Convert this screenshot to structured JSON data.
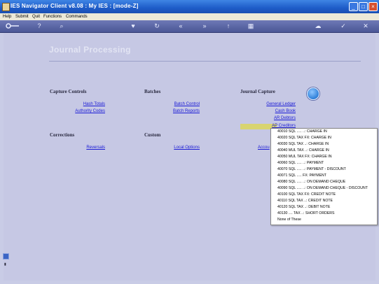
{
  "window": {
    "title": "IES Navigator Client v8.08 : My IES :      [mode-Z]"
  },
  "menu": [
    "Help",
    "Submit",
    "Quit",
    "Functions",
    "Commands"
  ],
  "page": {
    "title": "Journal Processing"
  },
  "sections": {
    "capture_controls": {
      "title": "Capture Controls",
      "links": [
        "Hash Totals",
        "Authority Codes"
      ]
    },
    "batches": {
      "title": "Batches",
      "links": [
        "Batch Control",
        "Batch Reports"
      ]
    },
    "journal_capture": {
      "title": "Journal Capture",
      "links": [
        "General Ledger",
        "Cash Book",
        "AR Debtors",
        "AP Creditors"
      ]
    },
    "corrections": {
      "title": "Corrections",
      "links": [
        "Reversals"
      ]
    },
    "custom": {
      "title": "Custom",
      "links": [
        "Local Options"
      ]
    },
    "partial_link": "Accou"
  },
  "popup": {
    "items": [
      "40010 SQL ..... ..: CHARGE IN",
      "40020 SQL TAX FX: CHARGE IN",
      "40030 SQL TAX ..: CHARGE IN",
      "40040 MUL TAX ..: CHARGE IN",
      "40050 MUL TAX FX: CHARGE IN",
      "40060 SQL ..... ..: PAYMENT",
      "40070 SQL ..... ..: PAYMENT - DISCOUNT",
      "40071 SQL ..... FX: PAYMENT",
      "40080 SQL ..... ..: ON DEMAND CHEQUE",
      "40090 SQL ..... ..: ON DEMAND CHEQUE - DISCOUNT",
      "40100 SQL TAX FX: CREDIT NOTE",
      "40110 SQL TAX ..: CREDIT NOTE",
      "40120 SQL TAX ..: DEBIT NOTE",
      "40130 .... TAX ..: SHORT ORDERS",
      "None of These"
    ]
  },
  "colors": {
    "titlebar": "#1e5cc8",
    "toolbar": "#4b5796",
    "content_bg": "#c6c8e4",
    "link": "#1a1ad6",
    "highlight": "#d8d470"
  },
  "icons": [
    "app-icon",
    "key-icon",
    "help-icon",
    "search-icon",
    "heart-icon",
    "refresh-icon",
    "rewind-icon",
    "fast-forward-icon",
    "up-icon",
    "calendar-icon",
    "cloud-icon",
    "check-icon",
    "close-icon",
    "info-icon"
  ]
}
